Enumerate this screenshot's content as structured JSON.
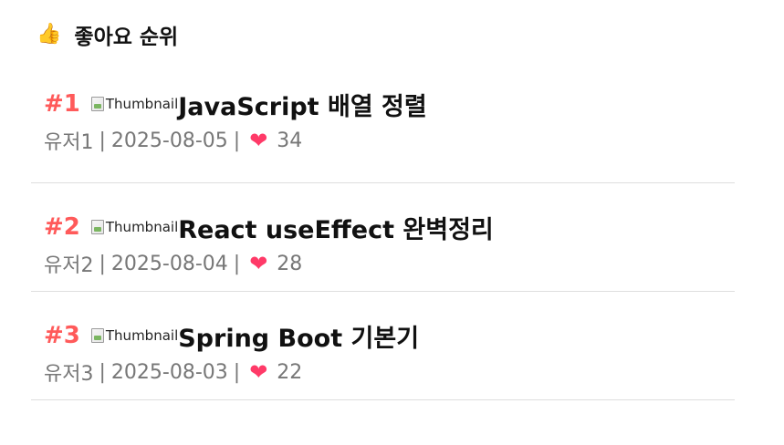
{
  "header": {
    "emoji": "👍",
    "title": "좋아요 순위"
  },
  "items": [
    {
      "rank": "#1",
      "thumb_alt": "Thumbnail",
      "title": "JavaScript 배열 정렬",
      "author": "유저1",
      "date": "2025-08-05",
      "likes": "34"
    },
    {
      "rank": "#2",
      "thumb_alt": "Thumbnail",
      "title": "React useEffect 완벽정리",
      "author": "유저2",
      "date": "2025-08-04",
      "likes": "28"
    },
    {
      "rank": "#3",
      "thumb_alt": "Thumbnail",
      "title": "Spring Boot 기본기",
      "author": "유저3",
      "date": "2025-08-03",
      "likes": "22"
    }
  ],
  "meta": {
    "separator": "|",
    "heart_icon": "❤"
  },
  "colors": {
    "rank": "#ff5a5a",
    "heart": "#ff3a68",
    "meta_text": "#777777",
    "divider": "#dedede"
  }
}
